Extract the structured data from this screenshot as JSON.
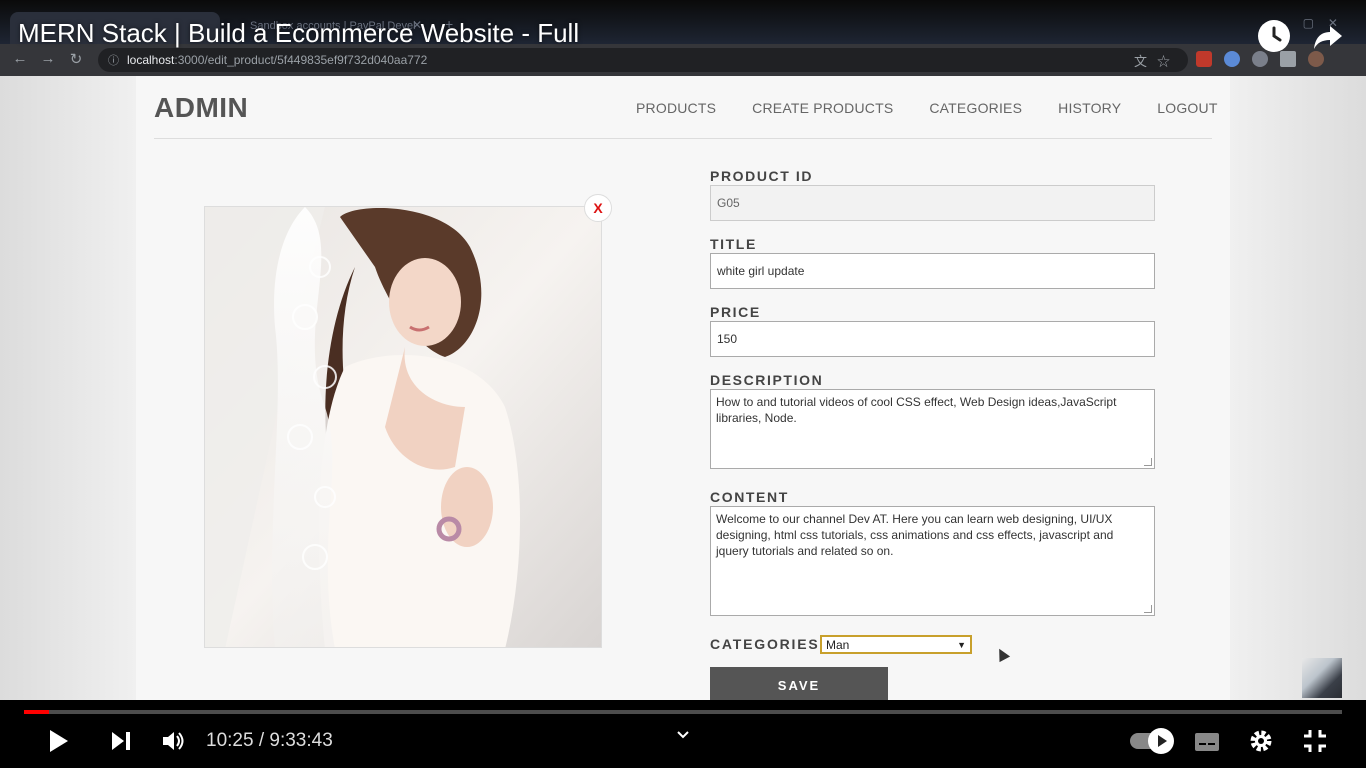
{
  "video": {
    "title": "MERN Stack | Build a Ecommerce Website - Full",
    "time_display": "10:25 / 9:33:43",
    "progress": 0.0186
  },
  "browser": {
    "tab2_label": "Sandbox accounts | PayPal Devel",
    "url_host": "localhost",
    "url_path": ":3000/edit_product/5f449835ef9f732d040aa772"
  },
  "site": {
    "logo": "ADMIN",
    "menu": [
      "PRODUCTS",
      "CREATE PRODUCTS",
      "CATEGORIES",
      "HISTORY",
      "LOGOUT"
    ]
  },
  "form": {
    "image_close": "X",
    "product_id_label": "PRODUCT ID",
    "product_id_value": "G05",
    "title_label": "TITLE",
    "title_value": "white girl update",
    "price_label": "PRICE",
    "price_value": "150",
    "description_label": "DESCRIPTION",
    "description_value": "How to and tutorial videos of cool CSS effect, Web Design ideas,JavaScript libraries, Node.",
    "content_label": "CONTENT",
    "content_value": "Welcome to our channel Dev AT. Here you can learn web designing, UI/UX designing, html css tutorials, css animations and css effects, javascript and jquery tutorials and related so on.",
    "categories_label": "CATEGORIES:",
    "category_selected": "Man",
    "save_label": "SAVE"
  },
  "colors": {
    "accent_red": "#ff0000",
    "save_button": "#555555",
    "select_border": "#c8a02c",
    "close_x": "#dd1111"
  },
  "icons": {
    "play": "play-icon",
    "next": "next-icon",
    "volume": "volume-icon",
    "settings": "gear-icon",
    "fullscreen_exit": "exit-fullscreen-icon",
    "subtitles": "subtitles-icon",
    "watch_later": "clock-icon",
    "share": "share-icon"
  }
}
